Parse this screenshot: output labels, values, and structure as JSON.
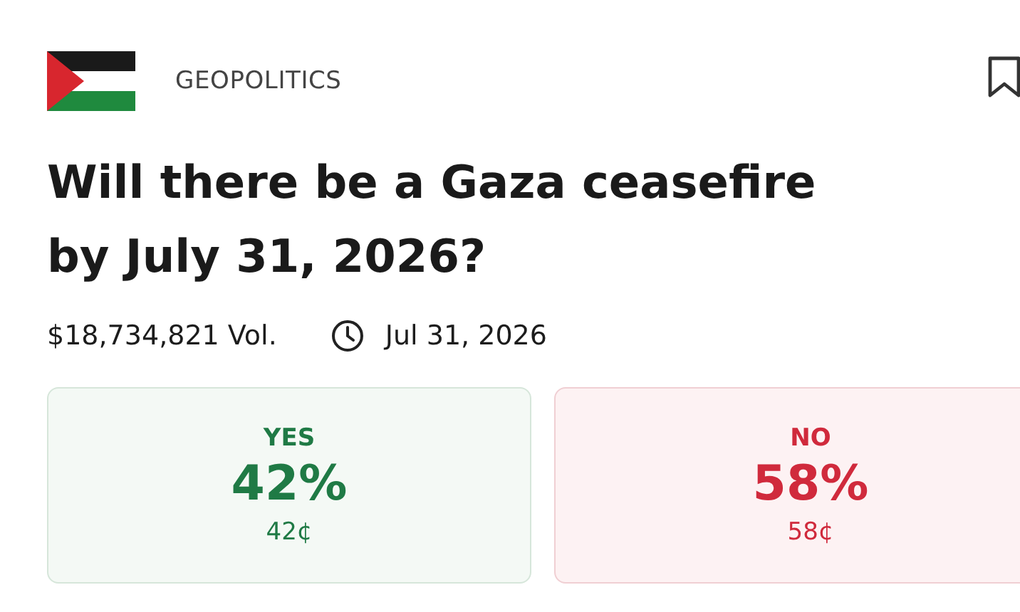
{
  "card": {
    "category": "GEOPOLITICS",
    "title": "Will there be a Gaza ceasefire by July 31, 2026?",
    "volume": "$18,734,821 Vol.",
    "end_date": "Jul 31, 2026",
    "outcomes": [
      {
        "kind": "yes",
        "label": "YES",
        "percent": "42%",
        "price": "42¢"
      },
      {
        "kind": "no",
        "label": "NO",
        "percent": "58%",
        "price": "58¢"
      }
    ]
  }
}
